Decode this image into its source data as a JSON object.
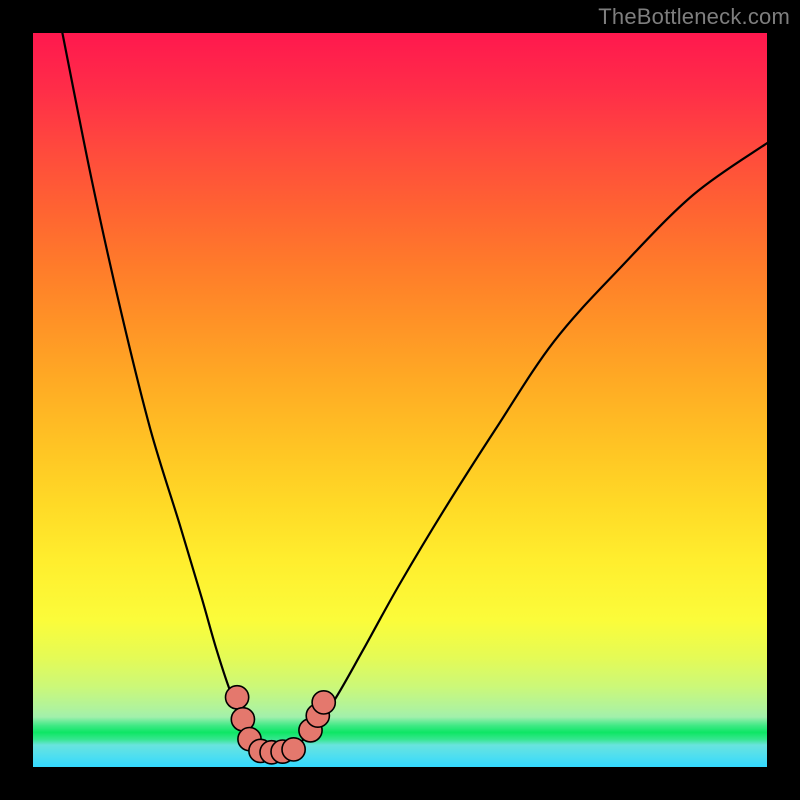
{
  "watermark": "TheBottleneck.com",
  "chart_data": {
    "type": "line",
    "title": "",
    "xlabel": "",
    "ylabel": "",
    "xlim": [
      0,
      100
    ],
    "ylim": [
      0,
      100
    ],
    "grid": false,
    "legend": false,
    "background": "gradient-rainbow-vertical",
    "series": [
      {
        "name": "curve",
        "x": [
          4,
          8,
          12,
          16,
          20,
          23,
          25,
          27,
          29,
          30.5,
          32,
          34,
          36,
          38,
          41,
          45,
          50,
          56,
          63,
          71,
          80,
          90,
          100
        ],
        "y": [
          100,
          80,
          62,
          46,
          33,
          23,
          16,
          10,
          6,
          3,
          2,
          2,
          3,
          5,
          9,
          16,
          25,
          35,
          46,
          58,
          68,
          78,
          85
        ]
      }
    ],
    "markers": [
      {
        "x": 27.8,
        "y": 9.5,
        "r": 1.0
      },
      {
        "x": 28.6,
        "y": 6.5,
        "r": 1.0
      },
      {
        "x": 29.5,
        "y": 3.8,
        "r": 1.0
      },
      {
        "x": 31.0,
        "y": 2.2,
        "r": 1.0
      },
      {
        "x": 32.5,
        "y": 2.0,
        "r": 1.0
      },
      {
        "x": 34.0,
        "y": 2.1,
        "r": 1.0
      },
      {
        "x": 35.5,
        "y": 2.4,
        "r": 1.0
      },
      {
        "x": 37.8,
        "y": 5.0,
        "r": 1.0
      },
      {
        "x": 38.8,
        "y": 7.0,
        "r": 1.0
      },
      {
        "x": 39.6,
        "y": 8.8,
        "r": 1.0
      }
    ]
  }
}
